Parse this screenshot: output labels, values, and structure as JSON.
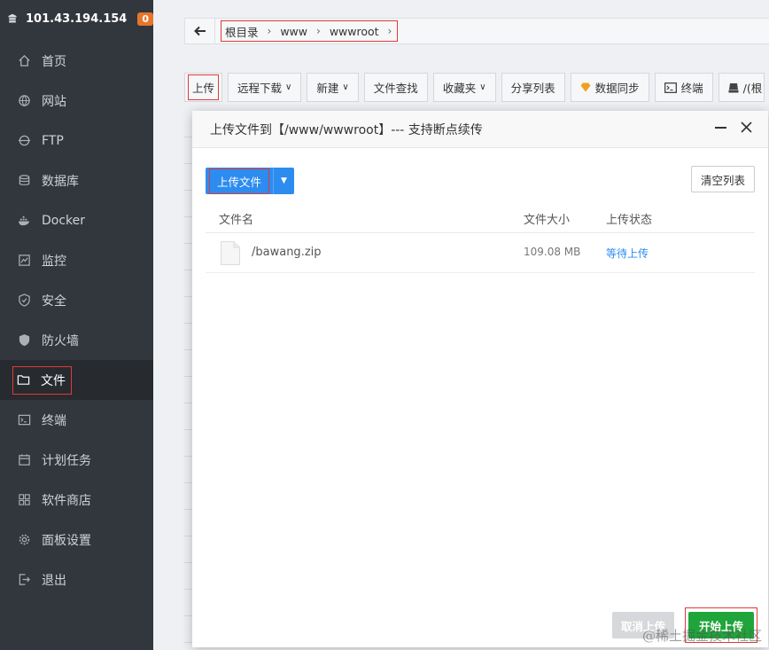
{
  "sidebar": {
    "host": "101.43.194.154",
    "badge": "0",
    "items": [
      {
        "label": "首页",
        "icon": "home-icon"
      },
      {
        "label": "网站",
        "icon": "globe-icon"
      },
      {
        "label": "FTP",
        "icon": "ftp-icon"
      },
      {
        "label": "数据库",
        "icon": "database-icon"
      },
      {
        "label": "Docker",
        "icon": "docker-icon"
      },
      {
        "label": "监控",
        "icon": "monitor-icon"
      },
      {
        "label": "安全",
        "icon": "shield-icon"
      },
      {
        "label": "防火墙",
        "icon": "firewall-icon"
      },
      {
        "label": "文件",
        "icon": "folder-icon"
      },
      {
        "label": "终端",
        "icon": "terminal-icon"
      },
      {
        "label": "计划任务",
        "icon": "calendar-icon"
      },
      {
        "label": "软件商店",
        "icon": "apps-icon"
      },
      {
        "label": "面板设置",
        "icon": "gear-icon"
      },
      {
        "label": "退出",
        "icon": "logout-icon"
      }
    ]
  },
  "path": {
    "crumbs": [
      "根目录",
      "www",
      "wwwroot"
    ]
  },
  "toolbar": {
    "upload": "上传",
    "remote_download": "远程下载",
    "new": "新建",
    "file_search": "文件查找",
    "favorites": "收藏夹",
    "share_list": "分享列表",
    "data_sync": "数据同步",
    "terminal": "终端",
    "disk": "/(根"
  },
  "modal": {
    "title": "上传文件到【/www/wwwroot】--- 支持断点续传",
    "upload_file_btn": "上传文件",
    "clear_list_btn": "清空列表",
    "columns": {
      "name": "文件名",
      "size": "文件大小",
      "status": "上传状态"
    },
    "files": [
      {
        "name": "/bawang.zip",
        "size": "109.08 MB",
        "status": "等待上传"
      }
    ],
    "cancel_btn": "取消上传",
    "start_btn": "开始上传"
  },
  "watermark": "@稀土掘金技术社区",
  "colors": {
    "accent_blue": "#2d8cf0",
    "start_green": "#20a53a",
    "sidebar_bg": "#32373e",
    "highlight_red": "#e03a3a"
  }
}
